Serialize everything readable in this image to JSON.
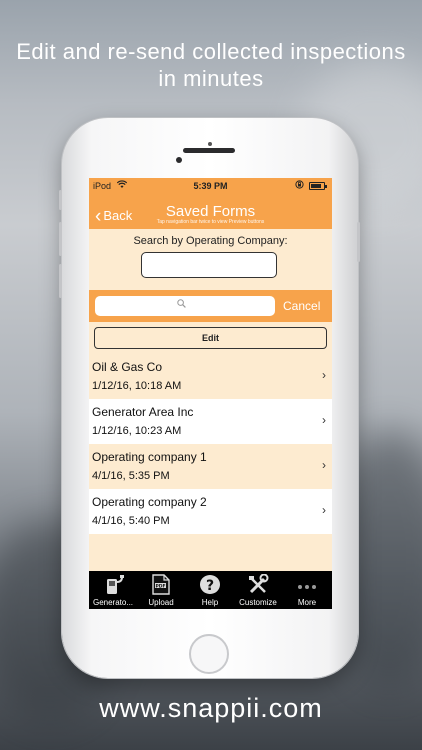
{
  "promo": {
    "headline_line1": "Edit and re-send collected inspections",
    "headline_line2": "in minutes",
    "website": "www.snappii.com"
  },
  "status_bar": {
    "carrier": "iPod",
    "time": "5:39 PM"
  },
  "nav": {
    "back_label": "Back",
    "title": "Saved Forms",
    "subtitle": "Tap navigation bar twice to view Preview buttons"
  },
  "search_company": {
    "label": "Search by Operating Company:",
    "value": ""
  },
  "search": {
    "value": "",
    "cancel_label": "Cancel"
  },
  "edit_label": "Edit",
  "forms": [
    {
      "name": "Oil & Gas Co",
      "date": "1/12/16, 10:18 AM"
    },
    {
      "name": "Generator Area Inc",
      "date": "1/12/16, 10:23 AM"
    },
    {
      "name": "Operating company 1",
      "date": "4/1/16, 5:35 PM"
    },
    {
      "name": "Operating company 2",
      "date": "4/1/16, 5:40 PM"
    }
  ],
  "tabs": [
    {
      "label": "Generato...",
      "icon": "generator-icon"
    },
    {
      "label": "Upload",
      "icon": "pdf-upload-icon"
    },
    {
      "label": "Help",
      "icon": "help-icon"
    },
    {
      "label": "Customize",
      "icon": "tools-icon"
    },
    {
      "label": "More",
      "icon": "more-icon"
    }
  ],
  "colors": {
    "accent": "#f7a34b",
    "row_tint": "#fdebd0",
    "tabbar": "#000000"
  }
}
